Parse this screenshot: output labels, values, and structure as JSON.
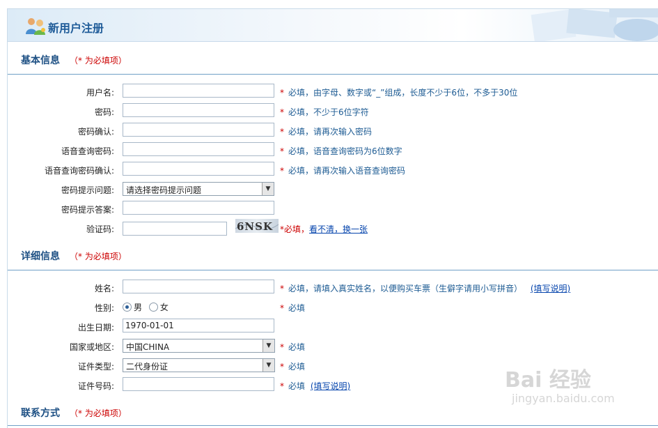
{
  "header": {
    "title": "新用户注册"
  },
  "sections": {
    "basic": {
      "title": "基本信息",
      "required_note": "（* 为必填项）"
    },
    "detail": {
      "title": "详细信息",
      "required_note": "（* 为必填项）"
    },
    "contact": {
      "title": "联系方式",
      "required_note": "（* 为必填项）"
    }
  },
  "basic_fields": {
    "username": {
      "label": "用户名:",
      "value": "",
      "hint_star": "*",
      "hint": "必填，由字母、数字或“_”组成，长度不少于6位，不多于30位"
    },
    "password": {
      "label": "密码:",
      "value": "",
      "hint_star": "*",
      "hint": "必填，不少于6位字符"
    },
    "password_confirm": {
      "label": "密码确认:",
      "value": "",
      "hint_star": "*",
      "hint": "必填，请再次输入密码"
    },
    "voice_password": {
      "label": "语音查询密码:",
      "value": "",
      "hint_star": "*",
      "hint": "必填，语音查询密码为6位数字"
    },
    "voice_password_confirm": {
      "label": "语音查询密码确认:",
      "value": "",
      "hint_star": "*",
      "hint": "必填，请再次输入语音查询密码"
    },
    "question": {
      "label": "密码提示问题:",
      "selected": "请选择密码提示问题"
    },
    "answer": {
      "label": "密码提示答案:",
      "value": ""
    },
    "captcha": {
      "label": "验证码:",
      "value": "",
      "image_text": "6NSK",
      "hint_prefix": "*必填，",
      "refresh_link": "看不清，换一张"
    }
  },
  "detail_fields": {
    "name": {
      "label": "姓名:",
      "value": "",
      "hint_star": "*",
      "hint": "必填，请填入真实姓名，以便购买车票（生僻字请用小写拼音）",
      "help_link": "(填写说明)"
    },
    "gender": {
      "label": "性别:",
      "options": [
        "男",
        "女"
      ],
      "selected": "男",
      "hint_star": "*",
      "hint": "必填"
    },
    "birth": {
      "label": "出生日期:",
      "value": "1970-01-01"
    },
    "country": {
      "label": "国家或地区:",
      "selected": "中国CHINA",
      "hint_star": "*",
      "hint": "必填"
    },
    "id_type": {
      "label": "证件类型:",
      "selected": "二代身份证",
      "hint_star": "*",
      "hint": "必填"
    },
    "id_number": {
      "label": "证件号码:",
      "value": "",
      "hint_star": "*",
      "hint": "必填",
      "help_link": "(填写说明)"
    }
  },
  "watermark": {
    "main": "Bai 经验",
    "sub": "jingyan.baidu.com"
  },
  "colors": {
    "accent": "#1c4f83",
    "required": "#cc0000",
    "hint": "#1d5b93"
  }
}
